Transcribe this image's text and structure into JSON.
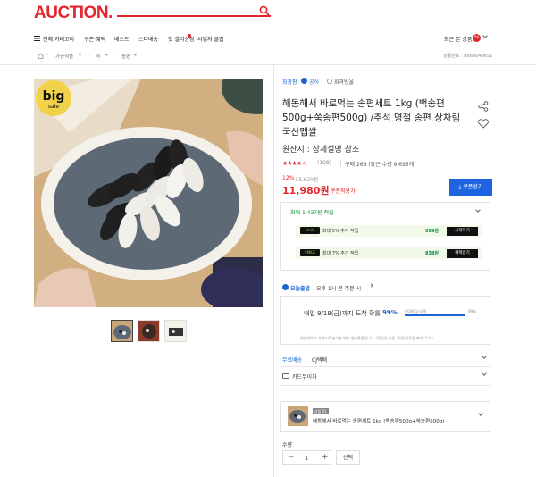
{
  "header": {
    "logo": "AUCTION."
  },
  "nav": {
    "all_categories": "전체 카테고리",
    "items": [
      "쿠폰·혜택",
      "베스트",
      "스타배송",
      "핫 셀러상점",
      "사업자 클럽"
    ],
    "recent": "최근 본 상품",
    "recent_count": "56"
  },
  "breadcrumb": {
    "items": [
      "가공식품",
      "떡",
      "송편"
    ],
    "product_code": "상품번호 : B663049652"
  },
  "store": {
    "name": "최광팜",
    "official": "공식",
    "other": "화과방울"
  },
  "product": {
    "title": "해동해서 바로먹는 송편세트 1kg (백송편500g+쑥송편500g) /추석 명절 송편 상차림 국산멥쌀",
    "origin": "원산지 : 상세설명 참조",
    "rating": 4.5,
    "review_count": "(108)",
    "purchase": "구매 268 (당근 수량 9,695개)",
    "discount_rate": "12%",
    "original_price": "13,620원",
    "price": "11,980원",
    "price_note": "쿠폰적용가",
    "coupon_button": "쿠폰받기"
  },
  "points": {
    "header": "최대 1,437원 적립",
    "rows": [
      {
        "badge": "smile",
        "text": "최대 5% 추가 적립",
        "amount": "599원",
        "button": "시작하기"
      },
      {
        "badge": "SMILE",
        "text": "최대 7% 추가 적립",
        "amount": "838원",
        "button": "혜택받기"
      }
    ]
  },
  "delivery": {
    "tag": "오늘출발",
    "cutoff": "오후 1시 전 주문 시",
    "estimate": "내일 9/18(금)까지 도착 확률",
    "percent": "99%",
    "chart_start": "9/18(금) 도착",
    "chart_end": "99%",
    "note": "배송데이터 기반으로 분석한 예측 배송확률입니다. (휴일일 기준, 주말/공휴일 제외) 5ctu",
    "fill": 0.99
  },
  "shipping": {
    "label": "무료배송",
    "carrier": "CJ택배"
  },
  "installment": {
    "label": "카드무이자"
  },
  "option": {
    "badge": "상품 01",
    "text": "해동해서 바로먹는 송편세트 1kg (백송편500g+쑥송편500g)"
  },
  "quantity": {
    "label": "수량",
    "value": "1",
    "select": "선택"
  },
  "badge_img": {
    "line1": "big",
    "line2": "sale"
  }
}
